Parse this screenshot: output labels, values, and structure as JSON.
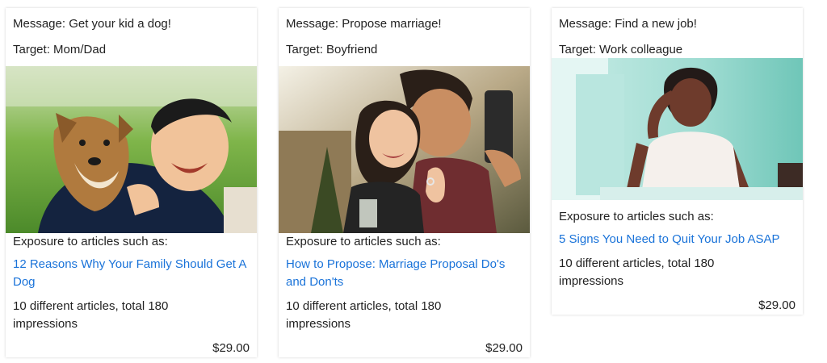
{
  "cards": [
    {
      "message": "Message: Get your kid a dog!",
      "target": "Target: Mom/Dad",
      "exposure_label": "Exposure to articles such as:",
      "article_link": "12 Reasons Why Your Family Should Get A Dog",
      "summary": "10 different articles, total 180 impressions",
      "price": "$29.00",
      "image": "photo-boy-with-dog"
    },
    {
      "message": "Message: Propose marriage!",
      "target": "Target: Boyfriend",
      "exposure_label": "Exposure to articles such as:",
      "article_link": "How to Propose: Marriage Proposal Do's and Don'ts",
      "summary": "10 different articles, total 180 impressions",
      "price": "$29.00",
      "image": "photo-engaged-couple-selfie"
    },
    {
      "message": "Message: Find a new job!",
      "target": "Target: Work colleague",
      "exposure_label": "Exposure to articles such as:",
      "article_link": "5 Signs You Need to Quit Your Job ASAP",
      "summary": "10 different articles, total 180 impressions",
      "price": "$29.00",
      "image": "photo-stressed-woman-at-desk"
    }
  ],
  "colors": {
    "link": "#1a73d9",
    "text": "#222222"
  }
}
